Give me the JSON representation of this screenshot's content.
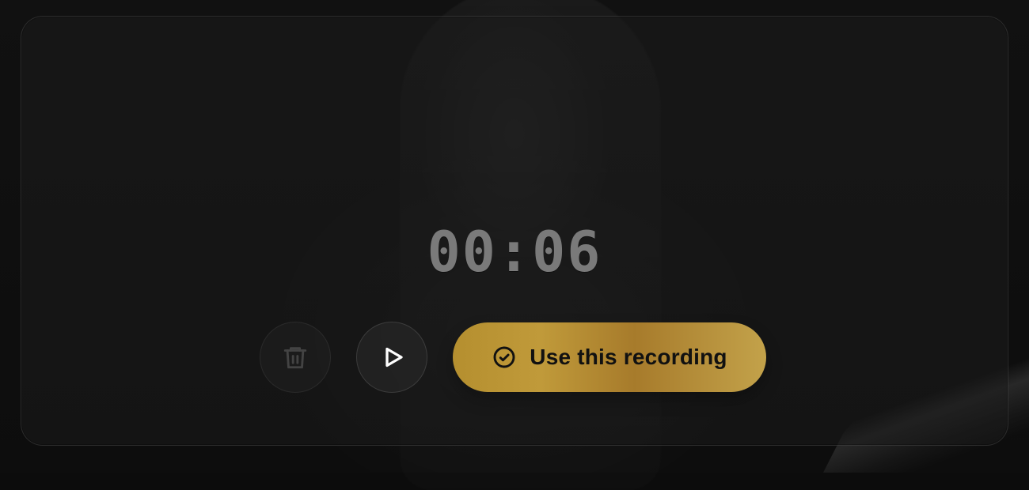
{
  "recorder": {
    "elapsed_time": "00:06",
    "actions": {
      "delete": {
        "label": "",
        "icon": "trash-icon"
      },
      "play": {
        "label": "",
        "icon": "play-icon"
      },
      "use": {
        "label": "Use this recording",
        "icon": "check-circle-icon"
      }
    }
  },
  "colors": {
    "accent_gold_start": "#b58f2f",
    "accent_gold_end": "#c3a24a"
  }
}
